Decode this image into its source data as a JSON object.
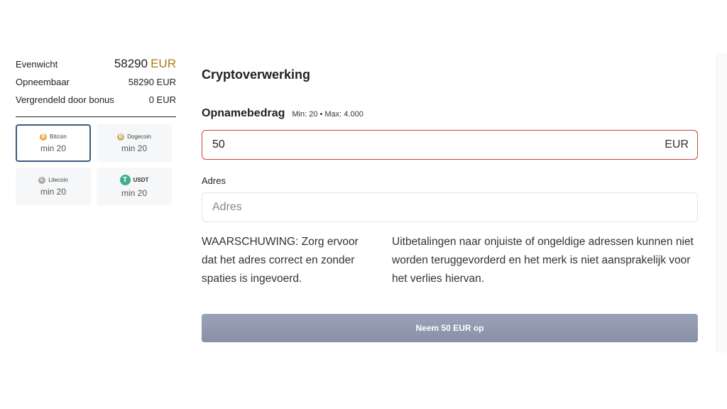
{
  "balance": {
    "rows": [
      {
        "label": "Evenwicht",
        "amount": "58290",
        "currency": "EUR"
      },
      {
        "label": "Opneembaar",
        "value": "58290 EUR"
      },
      {
        "label": "Vergrendeld door bonus",
        "value": "0 EUR"
      }
    ]
  },
  "coins": [
    {
      "name": "Bitcoin",
      "min": "min 20",
      "icon": "bitcoin-icon",
      "color": "#f2a33a",
      "glyph": "₿",
      "selected": true
    },
    {
      "name": "Dogecoin",
      "min": "min 20",
      "icon": "dogecoin-icon",
      "color": "#c9b36a",
      "glyph": "Ð",
      "selected": false
    },
    {
      "name": "Litecoin",
      "min": "min 20",
      "icon": "litecoin-icon",
      "color": "#a8a8a8",
      "glyph": "Ł",
      "selected": false
    },
    {
      "name": "USDT",
      "min": "min 20",
      "icon": "tether-icon",
      "color": "#3fae8a",
      "glyph": "T",
      "selected": false
    }
  ],
  "form": {
    "title": "Cryptoverwerking",
    "amount_label": "Opnamebedrag",
    "amount_hint": "Min: 20 • Max: 4.000",
    "amount_value": "50",
    "amount_currency": "EUR",
    "address_label": "Adres",
    "address_placeholder": "Adres",
    "warning_left": "WAARSCHUWING: Zorg ervoor dat het adres correct en zonder spaties is ingevoerd.",
    "warning_right": "Uitbetalingen naar onjuiste of ongeldige adressen kunnen niet worden teruggevorderd en het merk is niet aansprakelijk voor het verlies hiervan.",
    "submit_label": "Neem 50 EUR op"
  },
  "colors": {
    "accent_currency": "#b07a14",
    "amount_border": "#c9453a",
    "selected_border": "#3d5a80",
    "submit_button": "#8f98ae"
  }
}
